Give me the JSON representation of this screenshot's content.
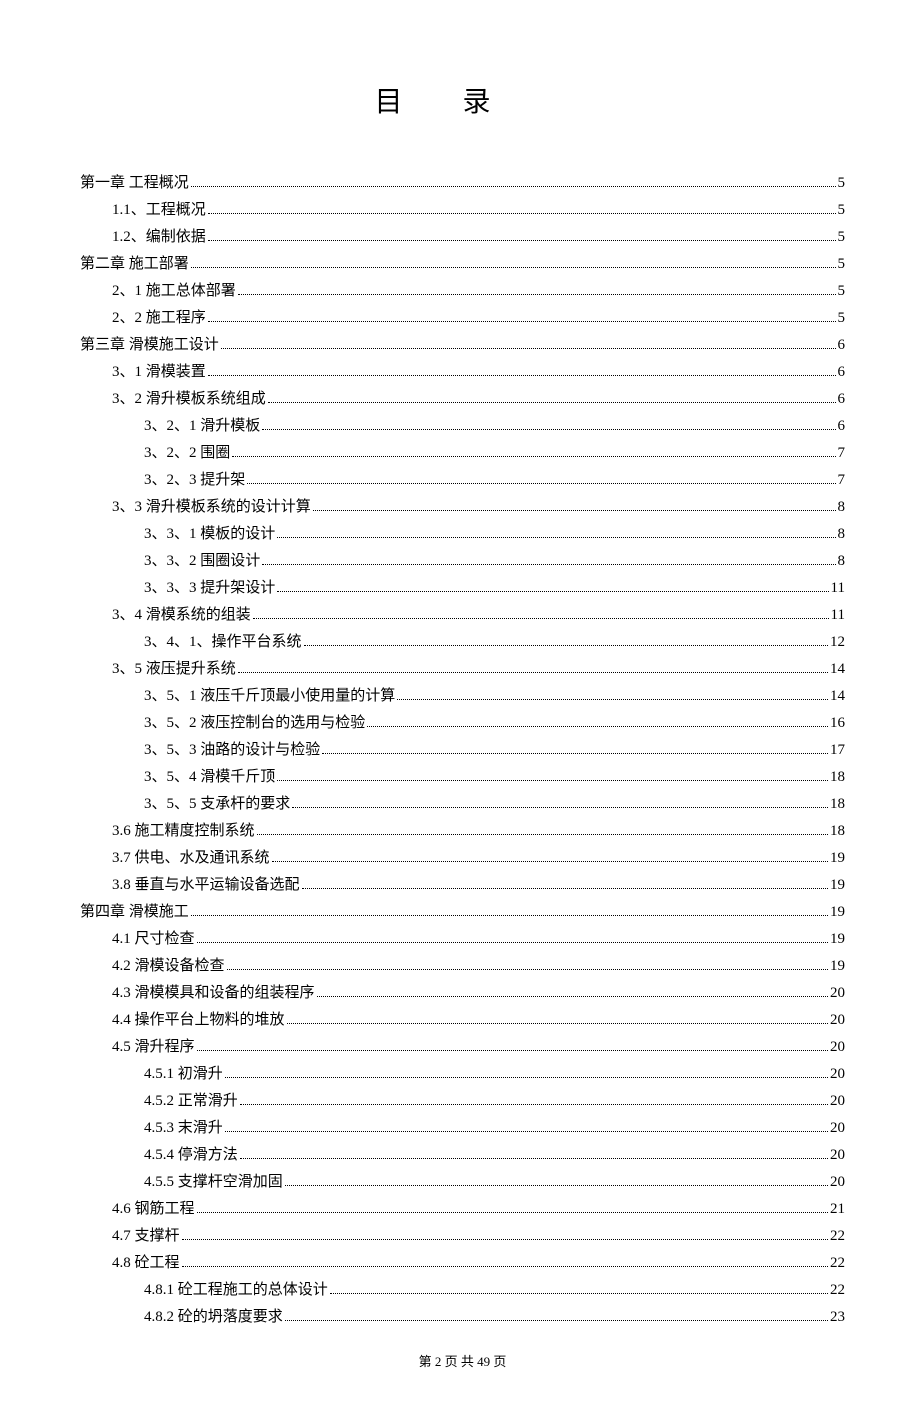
{
  "title": "目录",
  "footer": "第 2 页 共 49 页",
  "toc": [
    {
      "level": 0,
      "label": "第一章   工程概况",
      "page": "5"
    },
    {
      "level": 1,
      "label": "1.1、工程概况",
      "page": "5"
    },
    {
      "level": 1,
      "label": "1.2、编制依据",
      "page": "5"
    },
    {
      "level": 0,
      "label": "第二章   施工部署",
      "page": "5"
    },
    {
      "level": 1,
      "label": "2、1 施工总体部署",
      "page": "5"
    },
    {
      "level": 1,
      "label": "2、2 施工程序",
      "page": "5"
    },
    {
      "level": 0,
      "label": "第三章   滑模施工设计",
      "page": "6"
    },
    {
      "level": 1,
      "label": "3、1 滑模装置",
      "page": "6"
    },
    {
      "level": 1,
      "label": "3、2  滑升模板系统组成",
      "page": "6"
    },
    {
      "level": 2,
      "label": "3、2、1 滑升模板",
      "page": "6"
    },
    {
      "level": 2,
      "label": "3、2、2 围圈",
      "page": "7"
    },
    {
      "level": 2,
      "label": "3、2、3 提升架",
      "page": "7"
    },
    {
      "level": 1,
      "label": "3、3 滑升模板系统的设计计算",
      "page": "8"
    },
    {
      "level": 2,
      "label": "3、3、1 模板的设计",
      "page": "8"
    },
    {
      "level": 2,
      "label": "3、3、2 围圈设计",
      "page": "8"
    },
    {
      "level": 2,
      "label": "3、3、3 提升架设计",
      "page": "11"
    },
    {
      "level": 1,
      "label": "3、4 滑模系统的组装",
      "page": "11"
    },
    {
      "level": 2,
      "label": "3、4、1、操作平台系统",
      "page": "12"
    },
    {
      "level": 1,
      "label": "3、5 液压提升系统",
      "page": "14"
    },
    {
      "level": 2,
      "label": "3、5、1 液压千斤顶最小使用量的计算",
      "page": "14"
    },
    {
      "level": 2,
      "label": "3、5、2 液压控制台的选用与检验",
      "page": "16"
    },
    {
      "level": 2,
      "label": "3、5、3 油路的设计与检验",
      "page": "17"
    },
    {
      "level": 2,
      "label": "3、5、4 滑模千斤顶",
      "page": "18"
    },
    {
      "level": 2,
      "label": "3、5、5 支承杆的要求",
      "page": "18"
    },
    {
      "level": 1,
      "label": "3.6 施工精度控制系统",
      "page": "18"
    },
    {
      "level": 1,
      "label": "3.7 供电、水及通讯系统",
      "page": "19"
    },
    {
      "level": 1,
      "label": "3.8 垂直与水平运输设备选配",
      "page": "19"
    },
    {
      "level": 0,
      "label": "第四章   滑模施工",
      "page": "19"
    },
    {
      "level": 1,
      "label": "4.1 尺寸检查",
      "page": "19"
    },
    {
      "level": 1,
      "label": "4.2 滑模设备检查",
      "page": "19"
    },
    {
      "level": 1,
      "label": "4.3 滑模模具和设备的组装程序",
      "page": "20"
    },
    {
      "level": 1,
      "label": "4.4 操作平台上物料的堆放",
      "page": "20"
    },
    {
      "level": 1,
      "label": "4.5 滑升程序",
      "page": "20"
    },
    {
      "level": 2,
      "label": "4.5.1 初滑升",
      "page": "20"
    },
    {
      "level": 2,
      "label": "4.5.2 正常滑升",
      "page": "20"
    },
    {
      "level": 2,
      "label": "4.5.3 末滑升",
      "page": "20"
    },
    {
      "level": 2,
      "label": "4.5.4 停滑方法",
      "page": "20"
    },
    {
      "level": 2,
      "label": "4.5.5 支撑杆空滑加固",
      "page": "20"
    },
    {
      "level": 1,
      "label": "4.6 钢筋工程",
      "page": "21"
    },
    {
      "level": 1,
      "label": "4.7 支撑杆",
      "page": "22"
    },
    {
      "level": 1,
      "label": "4.8 砼工程",
      "page": "22"
    },
    {
      "level": 2,
      "label": "4.8.1 砼工程施工的总体设计",
      "page": "22"
    },
    {
      "level": 2,
      "label": "4.8.2 砼的坍落度要求",
      "page": "23"
    }
  ]
}
